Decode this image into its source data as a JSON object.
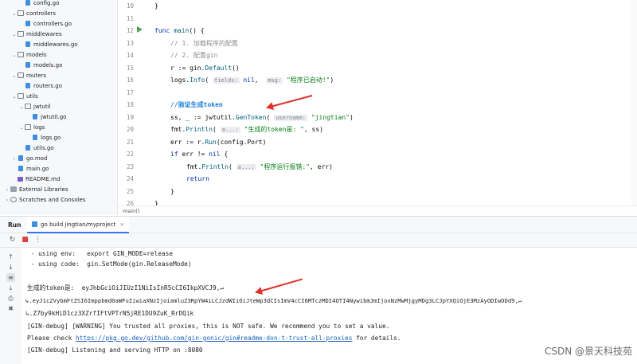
{
  "tree": {
    "items": [
      {
        "label": "config.go",
        "type": "gofile",
        "indent": 3,
        "arrow": ""
      },
      {
        "label": "controllers",
        "type": "folder",
        "indent": 2,
        "arrow": "⌄"
      },
      {
        "label": "controllers.go",
        "type": "gofile",
        "indent": 3,
        "arrow": ""
      },
      {
        "label": "middlewares",
        "type": "folder",
        "indent": 2,
        "arrow": "⌄"
      },
      {
        "label": "middlewares.go",
        "type": "gofile",
        "indent": 3,
        "arrow": ""
      },
      {
        "label": "models",
        "type": "folder",
        "indent": 2,
        "arrow": "⌄"
      },
      {
        "label": "models.go",
        "type": "gofile",
        "indent": 3,
        "arrow": ""
      },
      {
        "label": "routers",
        "type": "folder",
        "indent": 2,
        "arrow": "⌄"
      },
      {
        "label": "routers.go",
        "type": "gofile",
        "indent": 3,
        "arrow": ""
      },
      {
        "label": "utils",
        "type": "folder",
        "indent": 2,
        "arrow": "⌄"
      },
      {
        "label": "jwtutil",
        "type": "folder",
        "indent": 3,
        "arrow": "⌄"
      },
      {
        "label": "jwtutil.go",
        "type": "gofile",
        "indent": 4,
        "arrow": ""
      },
      {
        "label": "logs",
        "type": "folder",
        "indent": 3,
        "arrow": "⌄"
      },
      {
        "label": "logs.go",
        "type": "gofile",
        "indent": 4,
        "arrow": ""
      },
      {
        "label": "utils.go",
        "type": "gofile",
        "indent": 3,
        "arrow": ""
      },
      {
        "label": "go.mod",
        "type": "gofile",
        "indent": 2,
        "arrow": "›"
      },
      {
        "label": "main.go",
        "type": "gofile",
        "indent": 2,
        "arrow": ""
      },
      {
        "label": "README.md",
        "type": "md",
        "indent": 2,
        "arrow": ""
      },
      {
        "label": "External Libraries",
        "type": "lib",
        "indent": 1,
        "arrow": "›"
      },
      {
        "label": "Scratches and Consoles",
        "type": "scratch",
        "indent": 1,
        "arrow": "›"
      }
    ]
  },
  "editor": {
    "line_numbers": [
      "10",
      "11",
      "12",
      "13",
      "14",
      "15",
      "16",
      "17",
      "18",
      "19",
      "20",
      "21",
      "22",
      "23",
      "24",
      "25",
      "26"
    ],
    "line10": "}",
    "l12_kw": "func",
    "l12_fn": "main",
    "l12_rest": "() {",
    "l13": "// 1. 加载程序的配置",
    "l14": "// 2. 配置gin",
    "l15_a": "r := ",
    "l15_pkg": "gin",
    "l15_call": "Default",
    "l15_b": "()",
    "l16_pkg": "logs",
    "l16_call": "Info",
    "l16_hint1": "fields:",
    "l16_kw": "nil",
    "l16_hint2": "msg:",
    "l16_str": "\"程序已启动!\"",
    "l16_end": ")",
    "l18_cm": "//验证生成token",
    "l19_a": "ss, _ := ",
    "l19_pkg": "jwtutil",
    "l19_call": "GenToken",
    "l19_hint": "username:",
    "l19_str": "\"jingtian\"",
    "l19_end": ")",
    "l20_pkg": "fmt",
    "l20_call": "Println",
    "l20_hint": "a...:",
    "l20_str": "\"生成的token是: \"",
    "l20_end": ", ss)",
    "l21_a": "err := r.",
    "l21_call": "Run",
    "l21_b": "(config.Port)",
    "l22_kw": "if",
    "l22_a": " err != ",
    "l22_kw2": "nil",
    "l22_b": " {",
    "l23_pkg": "fmt",
    "l23_call": "Println",
    "l23_hint": "a...:",
    "l23_str": "\"程序运行报错:\"",
    "l23_end": ", err)",
    "l24_kw": "return",
    "l25": "}",
    "l26": "}",
    "breadcrumb": "main()"
  },
  "run_panel": {
    "label": "Run",
    "tab_label": "go build jingtian/myproject",
    "tab_close": "×"
  },
  "console": {
    "lines": [
      " - using env:   export GIN_MODE=release",
      " - using code:  gin.SetMode(gin.ReleaseMode)",
      "",
      "生成的token是:  eyJhbGciOiJIUzI1NiIsInR5cCI6IkpXVCJ9,↵",
      "↳.eyJ1c2VybmFtZSI6Imppbmd0aWFuIiwiaXNzIjoiamluZ3RpYW4iLCJzdWIiOiJteWp3dCIsImV4cCI6MTczMDI4OTI4NywibmJmIjoxNzMwMjgyMDg3LCJpYXQiOjE3MzAyODIwODd9,↵",
      "↳.Z7by9kHiD1cz3XZrfIFtVPTrN5jRE1DU9ZuK_RrDQik",
      "[GIN-debug] [WARNING] You trusted all proxies, this is NOT safe. We recommend you to set a value.",
      "",
      "[GIN-debug] Listening and serving HTTP on :8080"
    ],
    "please_prefix": "Please check ",
    "please_link": "https://pkg.go.dev/github.com/gin-gonic/gin#readme-don-t-trust-all-proxies",
    "please_suffix": " for details."
  },
  "watermark": "CSDN @景天科技苑",
  "colors": {
    "accent": "#3574f0",
    "annotation": "#e0302a"
  }
}
